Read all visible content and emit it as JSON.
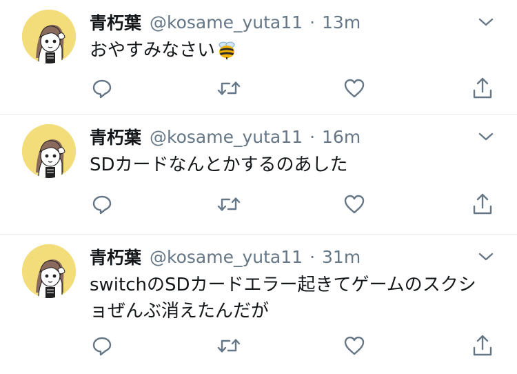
{
  "colors": {
    "text": "#14171a",
    "secondary": "#657786",
    "divider": "#e6ecf0",
    "avatar_bg": "#f3dd7a"
  },
  "icons": {
    "reply": "reply-icon",
    "retweet": "retweet-icon",
    "like": "like-icon",
    "share": "share-icon",
    "caret": "chevron-down-icon",
    "emoji": "bee-emoji"
  },
  "tweets": [
    {
      "display_name": "青朽葉",
      "handle": "@kosame_yuta11",
      "separator": "·",
      "time": "13m",
      "text": "おやすみなさい"
    },
    {
      "display_name": "青朽葉",
      "handle": "@kosame_yuta11",
      "separator": "·",
      "time": "16m",
      "text": "SDカードなんとかするのあした"
    },
    {
      "display_name": "青朽葉",
      "handle": "@kosame_yuta11",
      "separator": "·",
      "time": "31m",
      "text": "switchのSDカードエラー起きてゲームのスクショぜんぶ消えたんだが"
    }
  ]
}
